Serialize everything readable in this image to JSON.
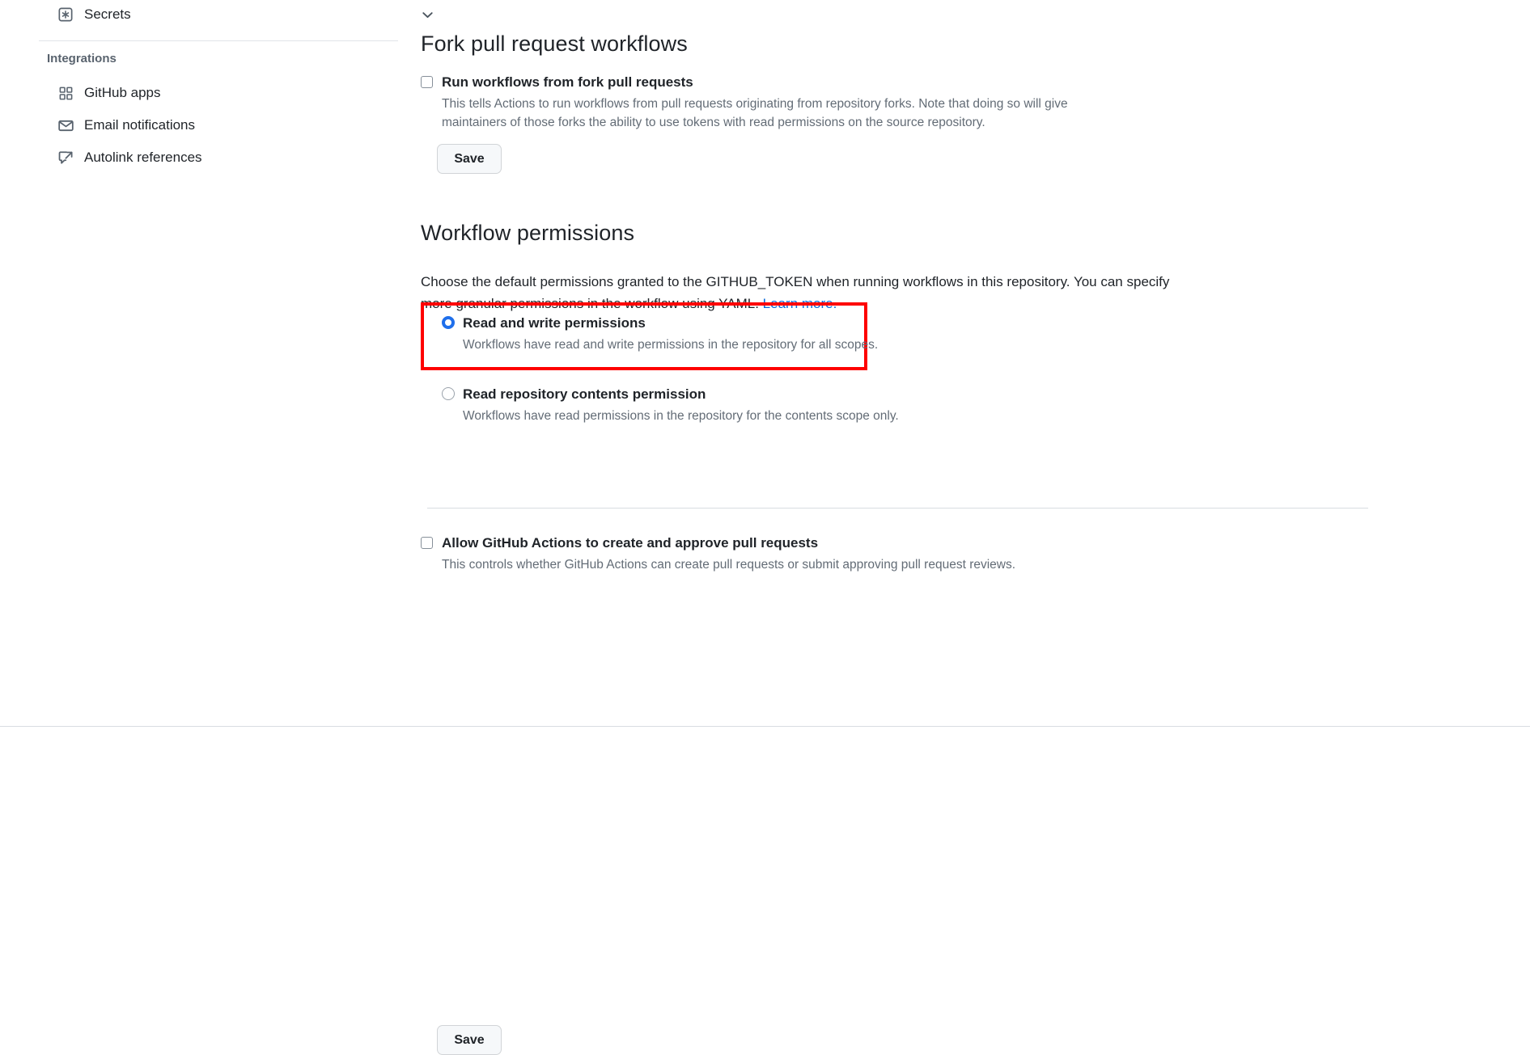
{
  "sidebar": {
    "secrets": {
      "label": "Secrets",
      "icon": "key-asterisk-icon",
      "chevron": "chevron-down-icon"
    },
    "group_title": "Integrations",
    "items": [
      {
        "label": "GitHub apps",
        "icon": "apps-grid-icon"
      },
      {
        "label": "Email notifications",
        "icon": "mail-icon"
      },
      {
        "label": "Autolink references",
        "icon": "cross-reference-icon"
      }
    ]
  },
  "main": {
    "fork_section": {
      "heading": "Fork pull request workflows",
      "checkbox": {
        "label": "Run workflows from fork pull requests",
        "description": "This tells Actions to run workflows from pull requests originating from repository forks. Note that doing so will give maintainers of those forks the ability to use tokens with read permissions on the source repository.",
        "checked": false
      },
      "save_label": "Save"
    },
    "workflow_permissions": {
      "heading": "Workflow permissions",
      "description_before_link": "Choose the default permissions granted to the GITHUB_TOKEN when running workflows in this repository. You can specify more granular permissions in the workflow using YAML. ",
      "link_text": "Learn more.",
      "options": [
        {
          "label": "Read and write permissions",
          "description": "Workflows have read and write permissions in the repository for all scopes.",
          "selected": true,
          "highlighted": true
        },
        {
          "label": "Read repository contents permission",
          "description": "Workflows have read permissions in the repository for the contents scope only.",
          "selected": false,
          "highlighted": false
        }
      ],
      "approve_checkbox": {
        "label": "Allow GitHub Actions to create and approve pull requests",
        "description": "This controls whether GitHub Actions can create pull requests or submit approving pull request reviews.",
        "checked": false
      },
      "save_label": "Save"
    }
  },
  "colors": {
    "link": "#0969da",
    "radio_selected": "#1f6feb",
    "highlight_box": "#fe0000",
    "muted_text": "#636c76",
    "button_bg": "#f6f8fa"
  }
}
